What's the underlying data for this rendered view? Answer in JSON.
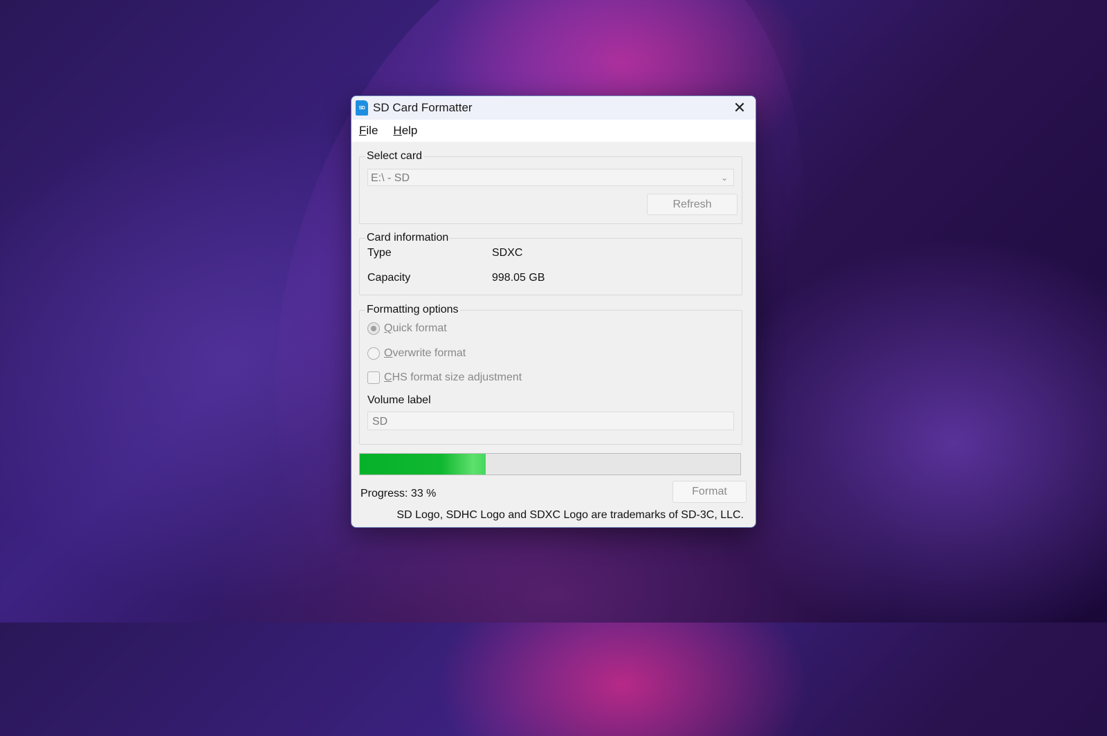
{
  "window": {
    "title": "SD Card Formatter",
    "close_glyph": "✕",
    "icon": "sd-card-icon",
    "icon_text": "SD"
  },
  "menu": {
    "items": [
      {
        "label": "File"
      },
      {
        "label": "Help"
      }
    ]
  },
  "select_card": {
    "legend": "Select card",
    "selected_value": "E:\\ - SD",
    "refresh_label": "Refresh"
  },
  "card_info": {
    "legend": "Card information",
    "type_label": "Type",
    "type_value": "SDXC",
    "capacity_label": "Capacity",
    "capacity_value": "998.05 GB"
  },
  "formatting": {
    "legend": "Formatting options",
    "quick_format": "Quick format",
    "overwrite_format": "Overwrite format",
    "chs_adjustment": "CHS format size adjustment",
    "volume_label_title": "Volume label",
    "volume_label_value": "SD"
  },
  "progress": {
    "percent": 33,
    "text": "Progress: 33 %",
    "fill_color": "#10b830"
  },
  "format_button": "Format",
  "trademark": "SD Logo, SDHC Logo and SDXC Logo are trademarks of SD-3C, LLC."
}
